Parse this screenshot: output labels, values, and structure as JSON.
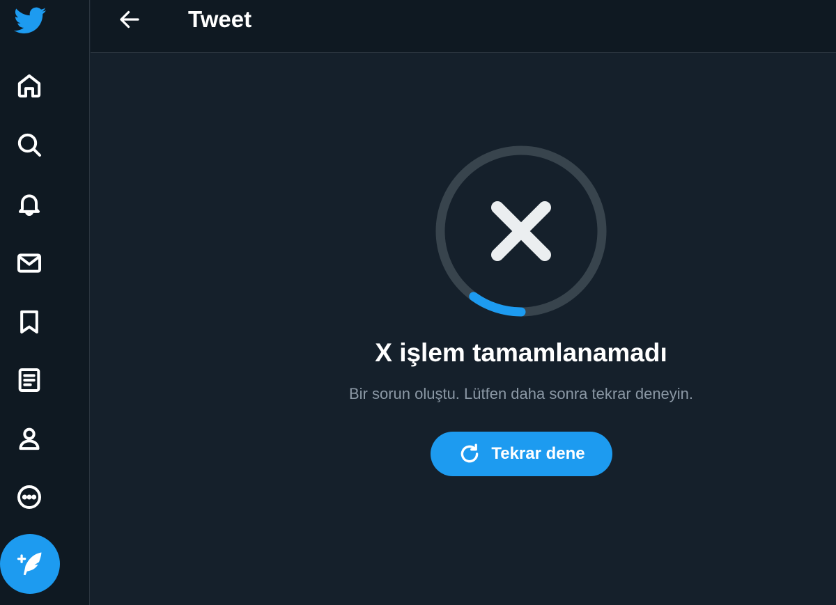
{
  "colors": {
    "accent": "#1d9bf0",
    "background": "#15202b",
    "sidebar_background": "#0f1922",
    "muted_text": "#8b98a5",
    "ring_track": "#38444d"
  },
  "sidebar": {
    "logo_icon": "twitter-bird-icon",
    "items": [
      {
        "icon": "home-icon"
      },
      {
        "icon": "search-icon"
      },
      {
        "icon": "bell-icon"
      },
      {
        "icon": "mail-icon"
      },
      {
        "icon": "bookmark-icon"
      },
      {
        "icon": "list-icon"
      },
      {
        "icon": "profile-icon"
      },
      {
        "icon": "more-icon"
      }
    ],
    "compose_icon": "compose-feather-icon"
  },
  "header": {
    "back_icon": "arrow-left-icon",
    "title": "Tweet"
  },
  "error": {
    "icon": "close-x-icon",
    "progress_fraction": 0.1,
    "title": "X işlem tamamlanamadı",
    "message": "Bir sorun oluştu. Lütfen daha sonra tekrar deneyin.",
    "retry_icon": "refresh-icon",
    "retry_label": "Tekrar dene"
  }
}
